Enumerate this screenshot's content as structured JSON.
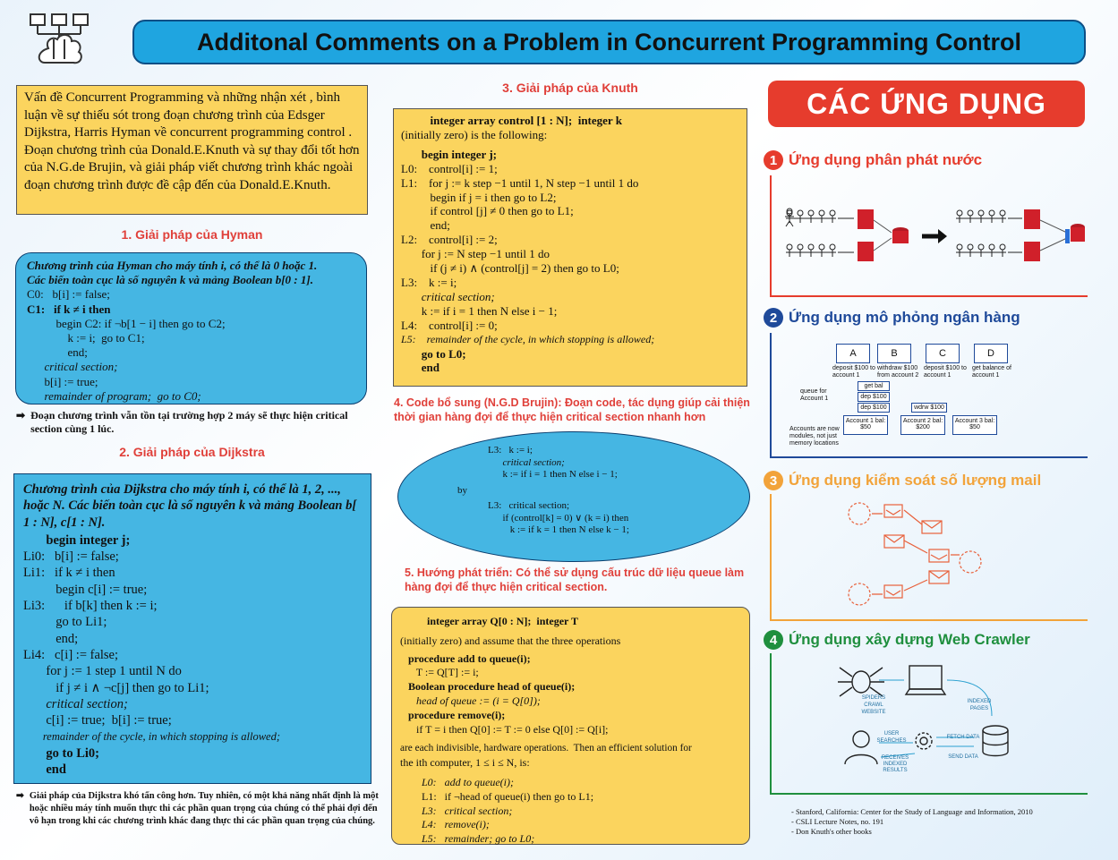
{
  "header": {
    "title": "Additonal Comments on a Problem in Concurrent Programming Control"
  },
  "intro": {
    "text": "Vấn đề Concurrent Programming và những nhận xét , bình luận về sự thiếu sót trong đoạn chương trình của Edsger Dijkstra, Harris Hyman về concurrent programming control . Đoạn chương trình của Donald.E.Knuth và sự thay đổi tốt hơn của N.G.de Brujin, và giải pháp viết chương trình khác ngoài đoạn chương trình được đề cập đến của Donald.E.Knuth."
  },
  "hyman": {
    "title": "1. Giải pháp của Hyman",
    "desc1": "Chương trình của Hyman cho máy tính i, có thể là 0 hoặc 1.",
    "desc2": "Các biến toàn cục là số nguyên k và mảng Boolean b[0 : 1].",
    "code": [
      "C0:   b[i] := false;",
      "C1:   if k ≠ i then",
      "          begin C2: if ¬b[1 − i] then go to C2;",
      "              k := i;  go to C1;",
      "              end;",
      "      critical section;",
      "      b[i] := true;",
      "      remainder of program;  go to C0;"
    ],
    "note": "Đoạn chương trình vẫn tồn tại trường hợp 2 máy sẽ thực hiện critical section cùng 1 lúc."
  },
  "dijkstra": {
    "title": "2. Giải pháp của Dijkstra",
    "desc": "Chương trình của Dijkstra cho máy tính i, có thể là 1, 2, ..., hoặc N.  Các biến toàn cục là số nguyên k và mảng Boolean b[ 1 : N], c[1 : N].",
    "code": [
      "       begin integer j;",
      "Li0:   b[i] := false;",
      "Li1:   if k ≠ i then",
      "          begin c[i] := true;",
      "Li3:      if b[k] then k := i;",
      "          go to Li1;",
      "          end;",
      "Li4:   c[i] := false;",
      "       for j := 1 step 1 until N do",
      "          if j ≠ i ∧ ¬c[j] then go to Li1;",
      "       critical section;",
      "       c[i] := true;  b[i] := true;",
      "       remainder of the cycle, in which stopping is allowed;",
      "       go to Li0;",
      "       end"
    ],
    "note": "Giải pháp của Dijkstra khó tấn công hơn. Tuy nhiên, có một khả năng nhất định là một hoặc nhiều máy tính muốn thực thi các phần quan trọng của chúng có thể phải đợi đến vô hạn  trong khi các chương trình khác đang thực thi các phần quan trọng của chúng."
  },
  "knuth": {
    "title": "3. Giải pháp của Knuth",
    "code": [
      "          integer array control [1 : N];  integer k",
      "(initially zero) is the following:",
      "       begin integer j;",
      "L0:    control[i] := 1;",
      "L1:    for j := k step −1 until 1, N step −1 until 1 do",
      "          begin if j = i then go to L2;",
      "          if control [j] ≠ 0 then go to L1;",
      "          end;",
      "L2:    control[i] := 2;",
      "       for j := N step −1 until 1 do",
      "          if (j ≠ i) ∧ (control[j] = 2) then go to L0;",
      "L3:    k := i;",
      "       critical section;",
      "       k := if i = 1 then N else i − 1;",
      "L4:    control[i] := 0;",
      "L5:    remainder of the cycle, in which stopping is allowed;",
      "       go to L0;",
      "       end"
    ]
  },
  "brujin": {
    "title": "4. Code bổ sung (N.G.D Brujin): Đoạn code, tác dụng giúp cải thiện thời gian hàng đợi để thực hiện critical section nhanh hơn",
    "code": [
      "L3:   k := i;",
      "      critical section;",
      "      k := if i = 1 then N else i − 1;",
      "by",
      "L3:   critical section;",
      "      if (control[k] = 0) ∨ (k = i) then",
      "         k := if k = 1 then N else k − 1;"
    ]
  },
  "future": {
    "title": "5. Hướng phát triển: Có thể sử dụng cấu trúc dữ liệu queue làm hàng đợi để thực hiện critical section.",
    "code": [
      "          integer array Q[0 : N];  integer T",
      "(initially zero) and assume that the three operations",
      "   procedure add to queue(i);",
      "      T := Q[T] := i;",
      "   Boolean procedure head of queue(i);",
      "      head of queue := (i = Q[0]);",
      "   procedure remove(i);",
      "      if T = i then Q[0] := T := 0 else Q[0] := Q[i];",
      "are each indivisible, hardware operations.  Then an efficient solution for",
      "the ith computer, 1 ≤ i ≤ N, is:",
      "        L0:   add to queue(i);",
      "        L1:   if ¬head of queue(i) then go to L1;",
      "        L3:   critical section;",
      "        L4:   remove(i);",
      "        L5:   remainder; go to L0;"
    ]
  },
  "apps": {
    "title": "CÁC ỨNG DỤNG",
    "items": [
      {
        "num": "1",
        "label": "Ứng dụng phân phát nước",
        "color": "#e63c2d"
      },
      {
        "num": "2",
        "label": "Ứng dụng mô phỏng ngân hàng",
        "color": "#1f4a9a"
      },
      {
        "num": "3",
        "label": "Ứng dụng kiểm soát số lượng mail",
        "color": "#f2a33a"
      },
      {
        "num": "4",
        "label": "Ứng dụng xây dựng Web Crawler",
        "color": "#1f8f3e"
      }
    ],
    "bank": {
      "accounts": [
        "A",
        "B",
        "C",
        "D"
      ],
      "ops": [
        "deposit $100 to account 1",
        "withdraw $100 from account 2",
        "deposit $100 to account 1",
        "get balance of account 1"
      ],
      "queue_label": "queue for Account 1",
      "queue_items": [
        "get bal",
        "dep $100",
        "dep $100"
      ],
      "wdrw": "wdrw $100",
      "balances": [
        "Account 1 bal: $50",
        "Account 2 bal: $200",
        "Account 3 bal: $50"
      ],
      "footnote": "Accounts are now modules, not just memory locations"
    },
    "crawler": {
      "labels": [
        "SPIDERS CRAWL WEBSITE",
        "INDEXED PAGES",
        "USER SEARCHES",
        "FETCH DATA",
        "RECEIVES INDEXED RESULTS",
        "SEND DATA"
      ]
    }
  },
  "references": [
    "- Stanford, California: Center for the Study of Language and Information, 2010",
    "- CSLI Lecture Notes, no. 191",
    "- Don Knuth's other books"
  ]
}
